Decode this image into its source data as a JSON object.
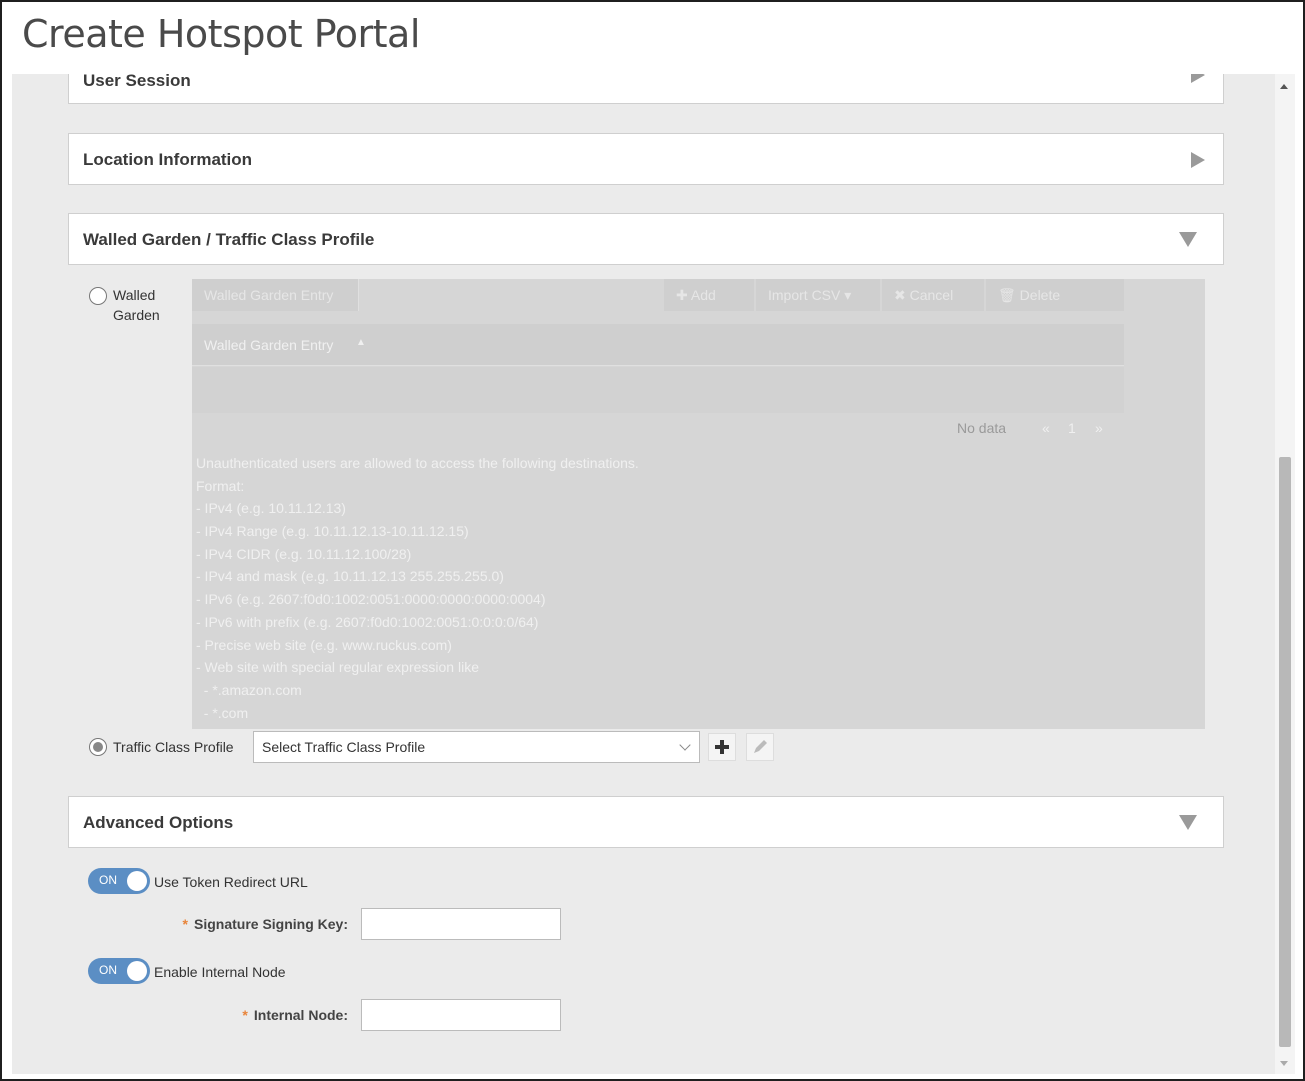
{
  "page_title": "Create Hotspot Portal",
  "sections": {
    "user_session": "User Session",
    "location_information": "Location Information",
    "walled_garden": "Walled Garden / Traffic Class Profile",
    "advanced_options": "Advanced Options"
  },
  "walled_garden": {
    "radio_label_line1": "Walled",
    "radio_label_line2": "Garden",
    "toolbar": {
      "entry_input": "Walled Garden Entry",
      "add": "Add",
      "import_csv": "Import CSV",
      "cancel": "Cancel",
      "delete": "Delete"
    },
    "table": {
      "column_header": "Walled Garden Entry",
      "no_data": "No data",
      "page": "1"
    },
    "help_lines": [
      "Unauthenticated users are allowed to access the following destinations.",
      "Format:",
      "- IPv4 (e.g. 10.11.12.13)",
      "- IPv4 Range (e.g. 10.11.12.13-10.11.12.15)",
      "- IPv4 CIDR (e.g. 10.11.12.100/28)",
      "- IPv4 and mask (e.g. 10.11.12.13 255.255.255.0)",
      "- IPv6 (e.g. 2607:f0d0:1002:0051:0000:0000:0000:0004)",
      "- IPv6 with prefix (e.g. 2607:f0d0:1002:0051:0:0:0:0/64)",
      "- Precise web site (e.g. www.ruckus.com)",
      "- Web site with special regular expression like",
      "  - *.amazon.com",
      "  - *.com"
    ]
  },
  "traffic_class": {
    "radio_label": "Traffic Class Profile",
    "select_placeholder": "Select Traffic Class Profile"
  },
  "advanced": {
    "toggle_on_text": "ON",
    "use_token_redirect": "Use Token Redirect URL",
    "signature_signing_key_label": "Signature Signing Key:",
    "signature_signing_key_value": "",
    "enable_internal_node": "Enable Internal Node",
    "internal_node_label": "Internal Node:",
    "internal_node_value": "",
    "required_mark": "*"
  },
  "colors": {
    "toggle_on": "#5b8ec4",
    "required": "#e8843a",
    "content_bg": "#ebebeb"
  }
}
